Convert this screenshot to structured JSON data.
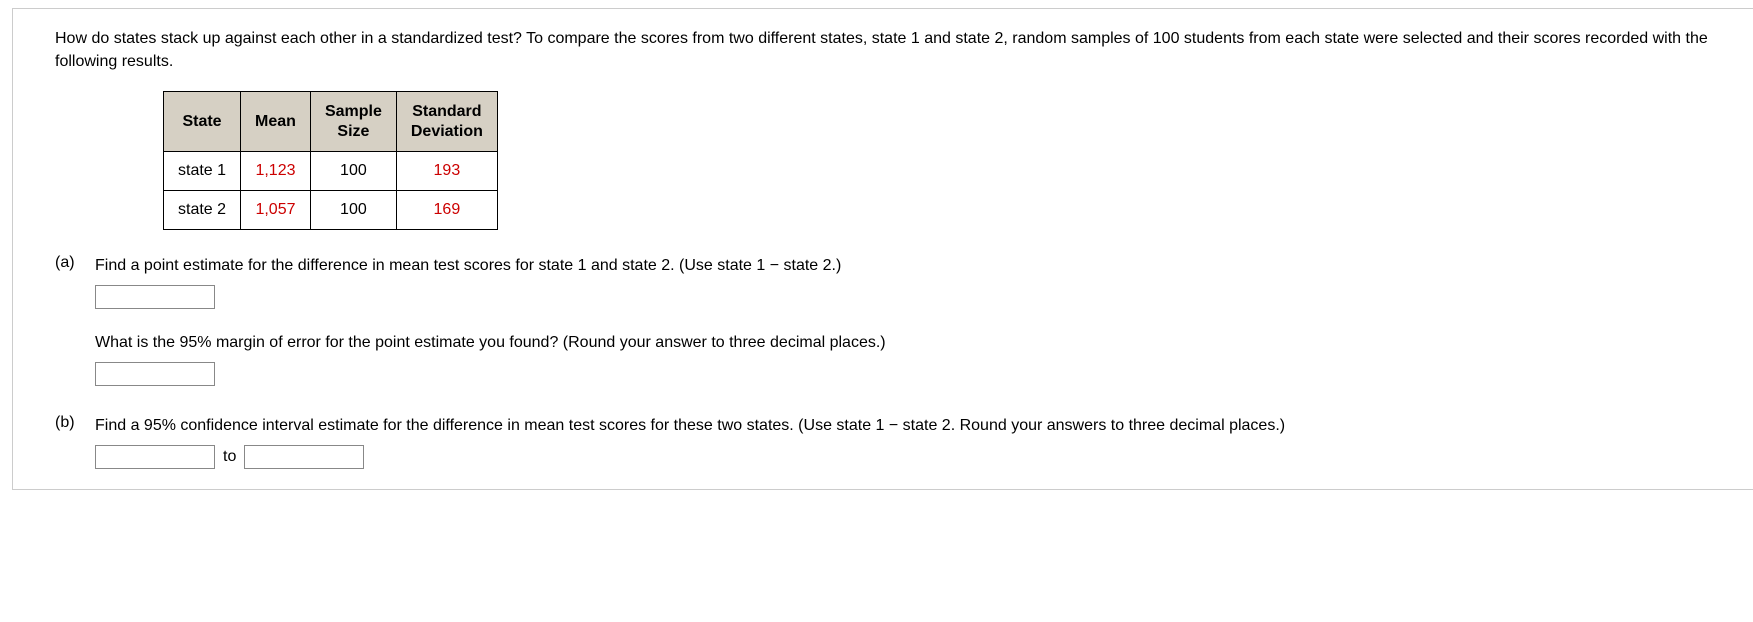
{
  "intro": "How do states stack up against each other in a standardized test? To compare the scores from two different states, state 1 and state 2, random samples of 100 students from each state were selected and their scores recorded with the following results.",
  "table": {
    "headers": {
      "state": "State",
      "mean": "Mean",
      "sample_size_l1": "Sample",
      "sample_size_l2": "Size",
      "std_l1": "Standard",
      "std_l2": "Deviation"
    },
    "rows": [
      {
        "state": "state 1",
        "mean": "1,123",
        "n": "100",
        "sd": "193"
      },
      {
        "state": "state 2",
        "mean": "1,057",
        "n": "100",
        "sd": "169"
      }
    ]
  },
  "parts": {
    "a": {
      "label": "(a)",
      "q1": "Find a point estimate for the difference in mean test scores for state 1 and state 2. (Use state 1 − state 2.)",
      "q2": "What is the 95% margin of error for the point estimate you found? (Round your answer to three decimal places.)"
    },
    "b": {
      "label": "(b)",
      "q1": "Find a 95% confidence interval estimate for the difference in mean test scores for these two states. (Use state 1 − state 2. Round your answers to three decimal places.)",
      "to": "to"
    }
  }
}
